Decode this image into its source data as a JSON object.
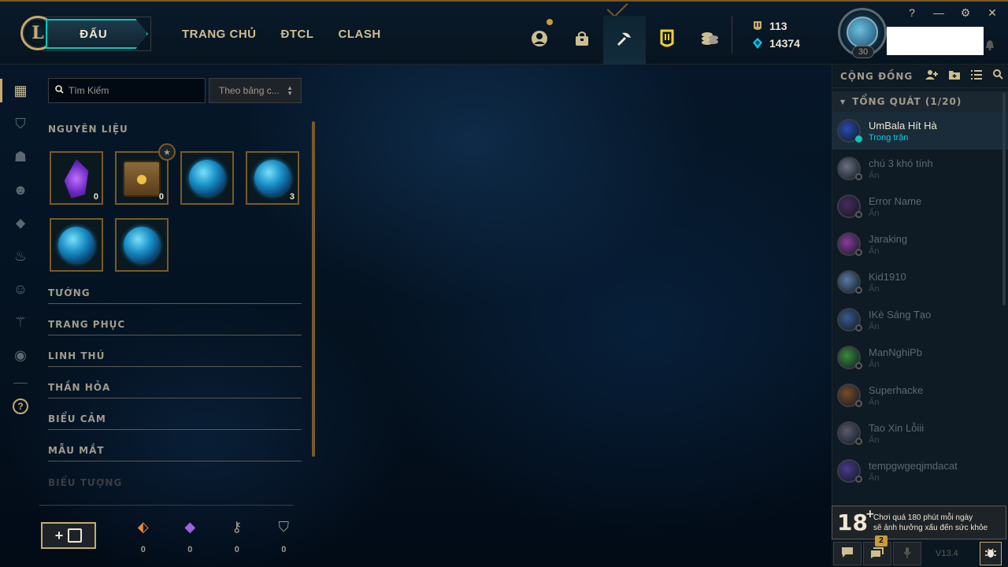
{
  "header": {
    "logo_text": "L",
    "play_label": "ĐẤU",
    "nav": [
      "TRANG CHỦ",
      "ĐTCL",
      "CLASH"
    ],
    "icons": [
      {
        "name": "profile-icon",
        "glyph": "◕"
      },
      {
        "name": "store-bag-icon",
        "glyph": "⛁"
      },
      {
        "name": "loot-icon",
        "glyph": "✂"
      },
      {
        "name": "collection-icon",
        "glyph": "Ս"
      },
      {
        "name": "currency-stack-icon",
        "glyph": "≋"
      }
    ],
    "rp": "113",
    "be": "14374",
    "level": "30",
    "window_controls": [
      "?",
      "—",
      "⚙",
      "✕"
    ]
  },
  "sidebar_icons": [
    {
      "name": "grid-icon",
      "glyph": "▦"
    },
    {
      "name": "chest-icon",
      "glyph": "⛉"
    },
    {
      "name": "helmet-icon",
      "glyph": "☗"
    },
    {
      "name": "mask-icon",
      "glyph": "☻"
    },
    {
      "name": "ward-icon",
      "glyph": "⬥"
    },
    {
      "name": "flame-icon",
      "glyph": "♨"
    },
    {
      "name": "emote-icon",
      "glyph": "☺"
    },
    {
      "name": "tree-icon",
      "glyph": "⚚"
    },
    {
      "name": "user-circle-icon",
      "glyph": "◉"
    }
  ],
  "help_glyph": "?",
  "collection": {
    "search_placeholder": "Tìm Kiếm",
    "sort_label": "Theo bảng c...",
    "materials_title": "NGUYÊN LIỆU",
    "materials": [
      {
        "type": "shard",
        "count": "0"
      },
      {
        "type": "chest",
        "count": "0",
        "badge": "★"
      },
      {
        "type": "orb",
        "count": ""
      },
      {
        "type": "orb",
        "count": "3"
      },
      {
        "type": "orb",
        "count": ""
      },
      {
        "type": "orb",
        "count": ""
      }
    ],
    "categories": [
      "TƯỚNG",
      "TRANG PHỤC",
      "LINH THÚ",
      "THẦN HỎA",
      "BIỂU CẢM",
      "MẪU MẮT",
      "BIỂU TƯỢNG"
    ]
  },
  "bottom": {
    "craft_plus": "+",
    "keys": [
      {
        "name": "key-fragment-orange-icon",
        "glyph": "⬖",
        "color": "#e8883a",
        "value": "0"
      },
      {
        "name": "gem-purple-icon",
        "glyph": "◆",
        "color": "#a060e0",
        "value": "0"
      },
      {
        "name": "key-icon",
        "glyph": "⚷",
        "color": "#a09b8c",
        "value": "0"
      },
      {
        "name": "chest-outline-icon",
        "glyph": "⛉",
        "color": "#a09b8c",
        "value": "0"
      }
    ]
  },
  "social": {
    "title": "CỘNG ĐỒNG",
    "group": "TỔNG QUÁT (1/20)",
    "friends": [
      {
        "name": "UmBala Hít Hà",
        "status": "Trong trận",
        "online": true,
        "color": "#2a4ab0"
      },
      {
        "name": "chú 3 khó tính",
        "status": "Ẩn",
        "online": false,
        "color": "#6a7080"
      },
      {
        "name": "Error Name",
        "status": "Ẩn",
        "online": false,
        "color": "#4a2a5a"
      },
      {
        "name": "Jaraking",
        "status": "Ẩn",
        "online": false,
        "color": "#8a3a9a"
      },
      {
        "name": "Kid1910",
        "status": "Ẩn",
        "online": false,
        "color": "#5a7aa0"
      },
      {
        "name": "IKè Sáng Tạo",
        "status": "Ẩn",
        "online": false,
        "color": "#3a5a8a"
      },
      {
        "name": "ManNghiPb",
        "status": "Ẩn",
        "online": false,
        "color": "#3a8a3a"
      },
      {
        "name": "Superhacke",
        "status": "Ẩn",
        "online": false,
        "color": "#7a4a2a"
      },
      {
        "name": "Tao Xin Lỗiii",
        "status": "Ẩn",
        "online": false,
        "color": "#5a5a6a"
      },
      {
        "name": "tempgwgeqjmdacat",
        "status": "Ẩn",
        "online": false,
        "color": "#4a3a8a"
      }
    ],
    "age_rating": "18",
    "age_plus": "+",
    "age_line1": "Chơi quá 180 phút mỗi ngày",
    "age_line2": "sẽ ảnh hưởng xấu đến sức khỏe",
    "notif_count": "2",
    "version": "V13.4"
  }
}
